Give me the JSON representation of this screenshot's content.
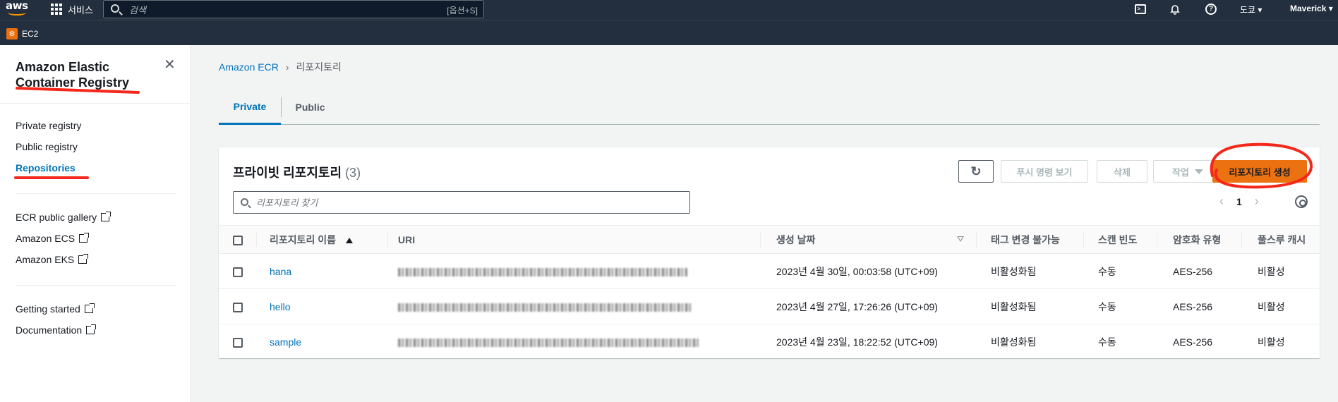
{
  "topnav": {
    "logo": "aws",
    "services_label": "서비스",
    "search_placeholder": "검색",
    "search_shortcut": "[옵션+S]",
    "region": "도쿄 ▾",
    "user": "Maverick ▾"
  },
  "favorites": [
    {
      "label": "EC2",
      "icon": "ec2-icon"
    }
  ],
  "sidebar": {
    "title": "Amazon Elastic Container Registry",
    "section1": [
      {
        "label": "Private registry"
      },
      {
        "label": "Public registry"
      },
      {
        "label": "Repositories",
        "active": true
      }
    ],
    "section2": [
      {
        "label": "ECR public gallery",
        "external": true
      },
      {
        "label": "Amazon ECS",
        "external": true
      },
      {
        "label": "Amazon EKS",
        "external": true
      }
    ],
    "section3": [
      {
        "label": "Getting started",
        "external": true
      },
      {
        "label": "Documentation",
        "external": true
      }
    ]
  },
  "breadcrumb": {
    "root": "Amazon ECR",
    "current": "리포지토리"
  },
  "tabs": [
    {
      "label": "Private",
      "active": true
    },
    {
      "label": "Public"
    }
  ],
  "panel": {
    "title": "프라이빗 리포지토리",
    "count": "(3)",
    "buttons": {
      "push": "푸시 명령 보기",
      "delete": "삭제",
      "actions": "작업",
      "create": "리포지토리 생성"
    },
    "filter_placeholder": "리포지토리 찾기",
    "page": "1"
  },
  "table": {
    "columns": [
      "리포지토리 이름",
      "URI",
      "생성 날짜",
      "태그 변경 불가능",
      "스캔 빈도",
      "암호화 유형",
      "풀스루 캐시"
    ],
    "rows": [
      {
        "name": "hana",
        "created": "2023년 4월 30일, 00:03:58 (UTC+09)",
        "immutability": "비활성화됨",
        "scan": "수동",
        "encryption": "AES-256",
        "pull_through": "비활성"
      },
      {
        "name": "hello",
        "created": "2023년 4월 27일, 17:26:26 (UTC+09)",
        "immutability": "비활성화됨",
        "scan": "수동",
        "encryption": "AES-256",
        "pull_through": "비활성"
      },
      {
        "name": "sample",
        "created": "2023년 4월 23일, 18:22:52 (UTC+09)",
        "immutability": "비활성화됨",
        "scan": "수동",
        "encryption": "AES-256",
        "pull_through": "비활성"
      }
    ]
  },
  "colors": {
    "nav_bg": "#232f3e",
    "accent": "#0073bb",
    "primary_button": "#ec7211",
    "annotation": "#f5271b"
  }
}
